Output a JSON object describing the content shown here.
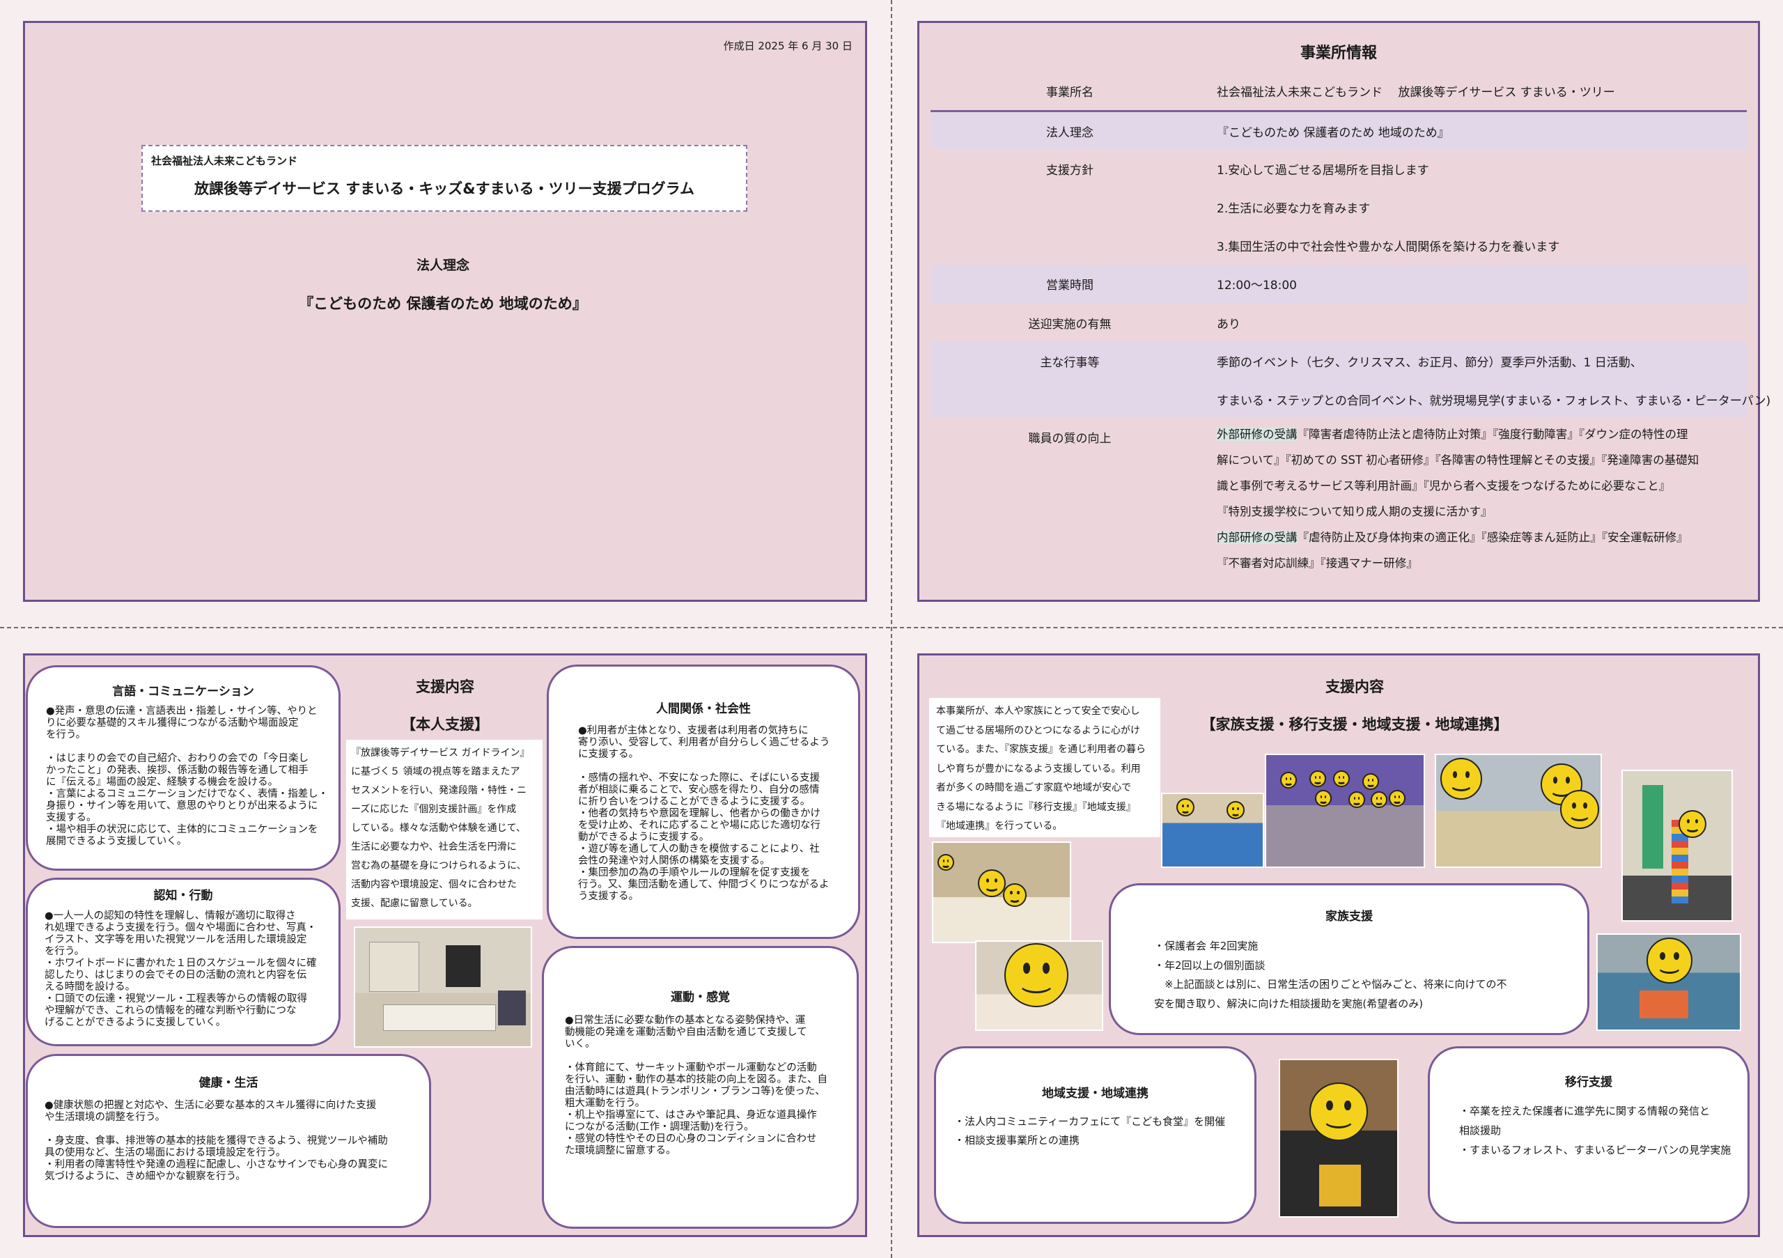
{
  "page1": {
    "created_date": "作成日 2025 年 6 月 30 日",
    "org_name": "社会福祉法人未来こどもランド",
    "program_title": "放課後等デイサービス すまいる・キッズ&すまいる・ツリー支援プログラム",
    "philosophy_heading": "法人理念",
    "philosophy_text": "『こどものため 保護者のため 地域のため』"
  },
  "page2": {
    "title": "事業所情報",
    "rows": [
      {
        "label": "事業所名",
        "value": "社会福祉法人未来こどもランド　 放課後等デイサービス すまいる・ツリー"
      },
      {
        "label": "法人理念",
        "value": "『こどものため 保護者のため 地域のため』"
      },
      {
        "label": "支援方針",
        "values": [
          "1.安心して過ごせる居場所を目指します",
          "2.生活に必要な力を育みます",
          "3.集団生活の中で社会性や豊かな人間関係を築ける力を養います"
        ]
      },
      {
        "label": "営業時間",
        "value": "12:00～18:00"
      },
      {
        "label": "送迎実施の有無",
        "value": "あり"
      },
      {
        "label": "主な行事等",
        "values": [
          "季節のイベント（七夕、クリスマス、お正月、節分）夏季戸外活動、1 日活動、",
          "すまいる・ステップとの合同イベント、就労現場見学(すまいる・フォレスト、すまいる・ピーターパン)"
        ]
      },
      {
        "label": "職員の質の向上",
        "values": [
          {
            "tag": "外部研修の受講",
            "text": "『障害者虐待防止法と虐待防止対策』『強度行動障害』『ダウン症の特性の理"
          },
          {
            "tag": "",
            "text": "解について』『初めての SST 初心者研修』『各障害の特性理解とその支援』『発達障害の基礎知"
          },
          {
            "tag": "",
            "text": "識と事例で考えるサービス等利用計画』『児から者へ支援をつなげるために必要なこと』"
          },
          {
            "tag": "",
            "text": "『特別支援学校について知り成人期の支援に活かす』"
          },
          {
            "tag": "内部研修の受講",
            "text": "『虐待防止及び身体拘束の適正化』『感染症等まん延防止』『安全運転研修』"
          },
          {
            "tag": "",
            "text": "『不審者対応訓練』『接遇マナー研修』"
          }
        ]
      }
    ]
  },
  "page3": {
    "title": "支援内容",
    "subtitle": "【本人支援】",
    "intro": "『放課後等デイサービス ガイドライン』\nに基づく５ 領域の視点等を踏まえたア\nセスメントを行い、発達段階・特性・ニ\nーズに応じた『個別支援計画』を作成\nしている。様々な活動や体験を通じて、\n生活に必要な力や、社会生活を円滑に\n営む為の基礎を身につけられるように、\n活動内容や環境設定、個々に合わせた\n支援、配慮に留意している。",
    "sections": {
      "language": {
        "title": "言語・コミュニケーション",
        "text": "●発声・意思の伝達・言語表出・指差し・サイン等、やりと\nりに必要な基礎的スキル獲得につながる活動や場面設定\nを行う。\n\n・はじまりの会での自己紹介、おわりの会での「今日楽し\nかったこと」の発表、挨拶、係活動の報告等を通して相手\nに『伝える』場面の設定、経験する機会を設ける。\n・言葉によるコミュニケーションだけでなく、表情・指差し・\n身振り・サイン等を用いて、意思のやりとりが出来るように\n支援する。\n・場や相手の状況に応じて、主体的にコミュニケーションを\n展開できるよう支援していく。"
      },
      "cognition": {
        "title": "認知・行動",
        "text": "●一人一人の認知の特性を理解し、情報が適切に取得さ\nれ処理できるよう支援を行う。個々や場面に合わせ、写真・\nイラスト、文字等を用いた視覚ツールを活用した環境設定\nを行う。\n・ホワイトボードに書かれた１日のスケジュールを個々に確\n認したり、はじまりの会でその日の活動の流れと内容を伝\nえる時間を設ける。\n・口頭での伝達・視覚ツール・工程表等からの情報の取得\nや理解ができ、これらの情報を的確な判断や行動につな\nげることができるように支援していく。"
      },
      "health": {
        "title": "健康・生活",
        "text": "●健康状態の把握と対応や、生活に必要な基本的スキル獲得に向けた支援\nや生活環境の調整を行う。\n\n・身支度、食事、排泄等の基本的技能を獲得できるよう、視覚ツールや補助\n具の使用など、生活の場面における環境設定を行う。\n・利用者の障害特性や発達の過程に配慮し、小さなサインでも心身の異変に\n気づけるように、きめ細やかな観察を行う。"
      },
      "social": {
        "title": "人間関係・社会性",
        "text": "●利用者が主体となり、支援者は利用者の気持ちに\n寄り添い、受容して、利用者が自分らしく過ごせるよう\nに支援する。\n\n・感情の揺れや、不安になった際に、そばにいる支援\n者が相談に乗ることで、安心感を得たり、自分の感情\nに折り合いをつけることができるように支援する。\n・他者の気持ちや意図を理解し、他者からの働きかけ\nを受け止め、それに応ずることや場に応じた適切な行\n動ができるように支援する。\n・遊び等を通して人の動きを模倣することにより、社\n会性の発達や対人関係の構築を支援する。\n・集団参加の為の手順やルールの理解を促す支援を\n行う。又、集団活動を通して、仲間づくりにつながるよ\nう支援する。"
      },
      "motor": {
        "title": "運動・感覚",
        "text": "●日常生活に必要な動作の基本となる姿勢保持や、運\n動機能の発達を運動活動や自由活動を通じて支援して\nいく。\n\n・体育館にて、サーキット運動やボール運動などの活動\nを行い、運動・動作の基本的技能の向上を図る。また、自\n由活動時には遊具(トランポリン・ブランコ等)を使った、\n粗大運動を行う。\n・机上や指導室にて、はさみや筆記具、身近な道具操作\nにつながる活動(工作・調理活動)を行う。\n・感覚の特性やその日の心身のコンディションに合わせ\nた環境調整に留意する。"
      }
    }
  },
  "page4": {
    "title": "支援内容",
    "subtitle": "【家族支援・移行支援・地域支援・地域連携】",
    "intro": "本事業所が、本人や家族にとって安全で安心し\nて過ごせる居場所のひとつになるように心がけ\nている。また、『家族支援』を通じ利用者の暮ら\nしや育ちが豊かになるよう支援している。利用\n者が多くの時間を過ごす家庭や地域が安心で\nきる場になるように『移行支援』『地域支援』\n『地域連携』を行っている。",
    "family": {
      "title": "家族支援",
      "lines": [
        "・保護者会 年2回実施",
        "・年2回以上の個別面談",
        "　※上記面談とは別に、日常生活の困りごとや悩みごと、将来に向けての不",
        "安を聞き取り、解決に向けた相談援助を実施(希望者のみ)"
      ]
    },
    "community": {
      "title": "地域支援・地域連携",
      "lines": [
        "・法人内コミュニティーカフェにて『こども食堂』を開催",
        "・相談支援事業所との連携"
      ]
    },
    "transition": {
      "title": "移行支援",
      "lines": [
        "・卒業を控えた保護者に進学先に関する情報の発信と",
        "相談援助",
        "・すまいるフォレスト、すまいるピーターパンの見学実施"
      ]
    }
  }
}
